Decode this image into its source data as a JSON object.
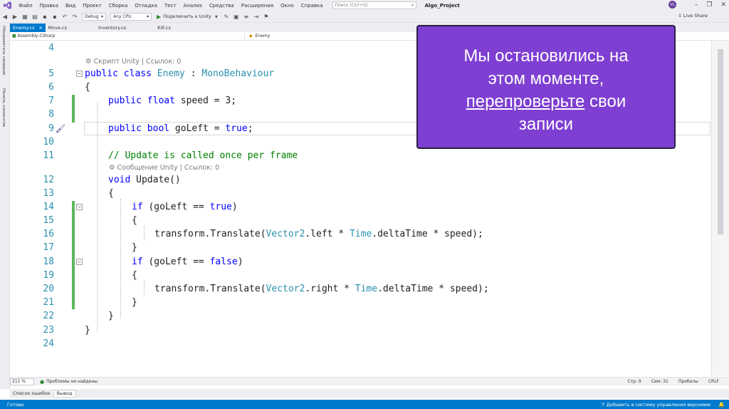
{
  "menubar": {
    "items": [
      "Файл",
      "Правка",
      "Вид",
      "Проект",
      "Сборка",
      "Отладка",
      "Тест",
      "Анализ",
      "Средства",
      "Расширения",
      "Окно",
      "Справка"
    ],
    "search_placeholder": "Поиск (Ctrl+Q)",
    "project_title": "Algo_Project",
    "avatar_initials": "VL"
  },
  "toolbar": {
    "config": "Debug",
    "platform": "Any CPU",
    "attach_label": "Подключить к Unity",
    "live_share": "Live Share"
  },
  "side_panels": {
    "server_explorer": "Обозреватель серверов",
    "toolbox": "Панель элементов"
  },
  "tabs": [
    {
      "label": "Enemy.cs",
      "active": true
    },
    {
      "label": "Move.cs",
      "active": false
    },
    {
      "label": "Inventory.cs",
      "active": false
    },
    {
      "label": "Kill.cs",
      "active": false
    }
  ],
  "navbar": {
    "project": "Assembly-CSharp",
    "class": "Enemy"
  },
  "codelens": {
    "class_hint": "Скрипт Unity | Ссылок: 0",
    "method_hint": "Сообщение Unity | Ссылок: 0"
  },
  "code": {
    "l4": "4",
    "l5": "5",
    "l5_kw": "public class",
    "l5_type": "Enemy",
    "l5_sep": " : ",
    "l5_base": "MonoBehaviour",
    "l6": "6",
    "l6_text": "{",
    "l7": "7",
    "l7_kw": "public float",
    "l7_rest": " speed = 3;",
    "l8": "8",
    "l9": "9",
    "l9_kw": "public bool",
    "l9_mid": " goLeft = ",
    "l9_val": "true",
    "l9_end": ";",
    "l10": "10",
    "l11": "11",
    "l11_comment": "// Update is called once per frame",
    "l12": "12",
    "l12_kw": "void",
    "l12_rest": " Update()",
    "l13": "13",
    "l13_text": "{",
    "l14": "14",
    "l14_kw": "if",
    "l14_mid": " (goLeft == ",
    "l14_val": "true",
    "l14_end": ")",
    "l15": "15",
    "l15_text": "{",
    "l16": "16",
    "l16_a": "transform.Translate(",
    "l16_t1": "Vector2",
    "l16_b": ".left * ",
    "l16_t2": "Time",
    "l16_c": ".deltaTime * speed);",
    "l17": "17",
    "l17_text": "}",
    "l18": "18",
    "l18_kw": "if",
    "l18_mid": " (goLeft == ",
    "l18_val": "false",
    "l18_end": ")",
    "l19": "19",
    "l19_text": "{",
    "l20": "20",
    "l20_a": "transform.Translate(",
    "l20_t1": "Vector2",
    "l20_b": ".right * ",
    "l20_t2": "Time",
    "l20_c": ".deltaTime * speed);",
    "l21": "21",
    "l21_text": "}",
    "l22": "22",
    "l22_text": "}",
    "l23": "23",
    "l23_text": "}",
    "l24": "24"
  },
  "statusrow": {
    "zoom": "211 %",
    "issues": "Проблемы не найдены",
    "line": "Стр: 9",
    "char": "Сим: 31",
    "spaces": "Пробелы",
    "eol": "CRLF"
  },
  "tool_tabs": [
    "Список ошибок",
    "Вывод"
  ],
  "bottom_status": {
    "ready": "Готово",
    "version_control": "Добавить в систему управления версиями"
  },
  "overlay": {
    "line1": "Мы остановились на",
    "line2": "этом моменте,",
    "line3_underlined": "перепроверьте",
    "line3_rest": " свои",
    "line4": "записи"
  },
  "colors": {
    "accent": "#007acc",
    "overlay_bg": "#7e3fd2",
    "keyword": "#0000ff",
    "type": "#2b91af",
    "comment": "#008000",
    "change_bar": "#5cb85c"
  }
}
